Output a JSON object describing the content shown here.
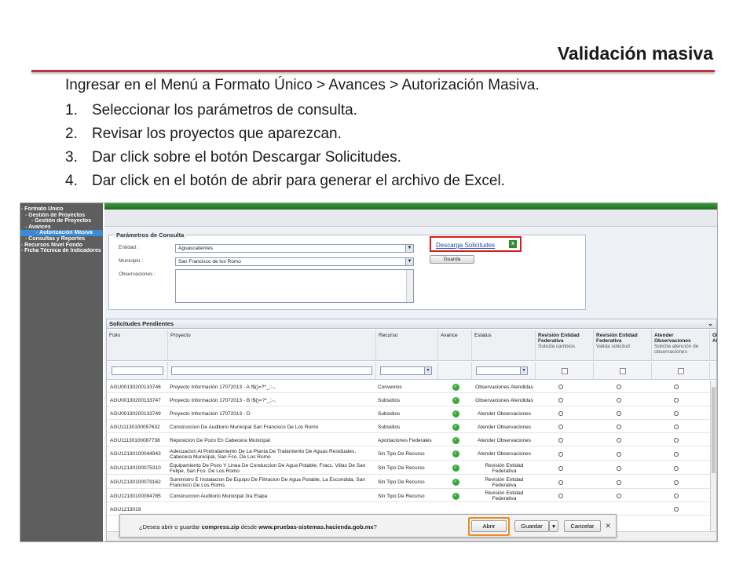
{
  "slide": {
    "title": "Validación masiva",
    "intro": "Ingresar en el Menú a Formato Único > Avances > Autorización Masiva.",
    "steps": [
      {
        "num": "1.",
        "text": "Seleccionar los parámetros de consulta."
      },
      {
        "num": "2.",
        "text": "Revisar los proyectos que aparezcan."
      },
      {
        "num": "3.",
        "text": "Dar click sobre el botón Descargar Solicitudes."
      },
      {
        "num": "4.",
        "text": "Dar click en el botón de abrir para generar el archivo de Excel."
      }
    ]
  },
  "sidebar": {
    "items": [
      {
        "label": "Formato Único"
      },
      {
        "label": "Gestión de Proyectos"
      },
      {
        "label": "Gestión de Proyectos"
      },
      {
        "label": "Avances"
      },
      {
        "label": "Autorización Masiva"
      },
      {
        "label": "Consultas y Reportes"
      },
      {
        "label": "Recursos Nivel Fondo"
      },
      {
        "label": "Ficha Técnica de Indicadores"
      }
    ]
  },
  "params": {
    "legend": "Parámetros de Consulta",
    "entidad_label": "Entidad :",
    "entidad_value": "Aguascalientes",
    "municipio_label": "Municipio :",
    "municipio_value": "San Francisco de los Romo",
    "observaciones_label": "Observaciones :",
    "descarga_link": "Descarga Solicitudes",
    "guarda_button": "Guarda"
  },
  "grid": {
    "title": "Solicitudes Pendientes",
    "headers": {
      "folio": "Folio",
      "proyecto": "Proyecto",
      "recurso": "Recurso",
      "avance": "Avance",
      "estatus": "Estatus",
      "rev_entidad": "Revisión Entidad Federativa",
      "rev_entidad_sub": "Solicita cambios",
      "rev_entidad2": "Revisión Entidad Federativa",
      "rev_entidad2_sub": "Valida solicitud",
      "atender": "Atender Observaciones",
      "atender_sub": "Solicita atención de observaciones",
      "ob": "Ob At"
    },
    "rows": [
      {
        "folio": "AGU00130200133746",
        "proyecto": "Proyecto Información 17072013 - A !$()=?*_;:-,",
        "recurso": "Convenios",
        "estatus": "Observaciones Atendidas"
      },
      {
        "folio": "AGU00130200133747",
        "proyecto": "Proyecto Información 17072013 - B !$()=?*_;:-,",
        "recurso": "Subsidios",
        "estatus": "Observaciones Atendidas"
      },
      {
        "folio": "AGU00130200133749",
        "proyecto": "Proyecto Información 17072013 - D",
        "recurso": "Subsidios",
        "estatus": "Atender Observaciones"
      },
      {
        "folio": "AGU11130100057632",
        "proyecto": "Construccion De Auditorio Municipal San Francisco De Los Romo",
        "recurso": "Subsidios",
        "estatus": "Atender Observaciones"
      },
      {
        "folio": "AGU11130100087738",
        "proyecto": "Reposicion De Pozo En Cabecera Municipal",
        "recurso": "Aportaciones Federales",
        "estatus": "Atender Observaciones"
      },
      {
        "folio": "AGU12130100044943",
        "proyecto": "Adecuacion Al Pretratamiento De La Planta De Tratamiento De Aguas Residuales, Cabecera Municipal, San Fco. De Los Romo",
        "recurso": "Sin Tipo De Recurso",
        "estatus": "Atender Observaciones"
      },
      {
        "folio": "AGU12130100075310",
        "proyecto": "Equipamiento De Pozo Y Linea De Conduccion De Agua Potable, Fracc. Villas De San Felipe, San Fco. De Los Romo",
        "recurso": "Sin Tipo De Recurso",
        "estatus": "Revisión Entidad Federativa"
      },
      {
        "folio": "AGU12130100079162",
        "proyecto": "Suministro E Instalacion De Equipo De Filtracion De Agua Potable, La Escondida, San Francisco De Los Romo.",
        "recurso": "Sin Tipo De Recurso",
        "estatus": "Revisión Entidad Federativa"
      },
      {
        "folio": "AGU12130100094785",
        "proyecto": "Construccion Auditorio Municipal 3ra Etapa",
        "recurso": "Sin Tipo De Recurso",
        "estatus": "Revisión Entidad Federativa"
      },
      {
        "folio": "AGU1213019",
        "proyecto": "",
        "recurso": "",
        "estatus": ""
      }
    ]
  },
  "download_bar": {
    "text_prefix": "¿Desea abrir o guardar ",
    "filename": "compress.zip",
    "text_mid": " desde ",
    "site": "www.pruebas-sistemas.hacienda.gob.mx",
    "text_suffix": "?",
    "abrir": "Abrir",
    "guardar": "Guardar",
    "cancelar": "Cancelar"
  },
  "colors": {
    "accent_rule": "#c0323c",
    "highlight_red": "#d81e1e",
    "highlight_orange": "#f08a1a",
    "sidebar": "#5e5e5e"
  }
}
